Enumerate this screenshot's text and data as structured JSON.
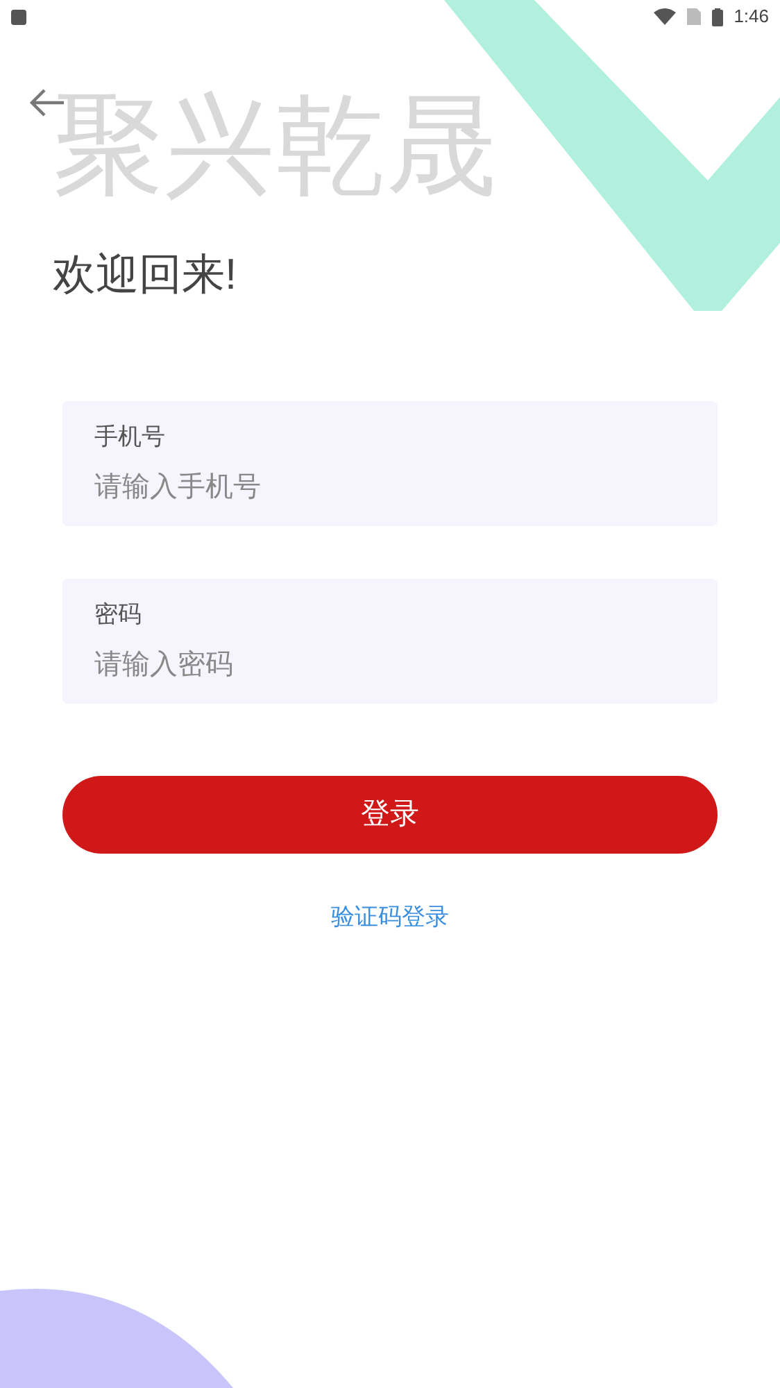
{
  "status_bar": {
    "time": "1:46"
  },
  "brand": "聚兴乾晟",
  "welcome": "欢迎回来!",
  "fields": [
    {
      "label": "手机号",
      "placeholder": "请输入手机号"
    },
    {
      "label": "密码",
      "placeholder": "请输入密码"
    }
  ],
  "login_button": "登录",
  "alt_login_link": "验证码登录"
}
